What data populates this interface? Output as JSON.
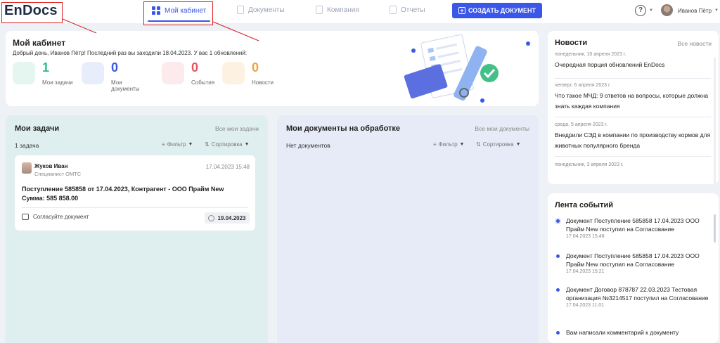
{
  "app": {
    "logo": "EnDocs"
  },
  "nav": {
    "cabinet": "Мой кабинет",
    "documents": "Документы",
    "company": "Компания",
    "reports": "Отчеты",
    "create": "СОЗДАТЬ ДОКУМЕНТ"
  },
  "user": {
    "name": "Иванов Пётр"
  },
  "cabinet": {
    "title": "Мой кабинет",
    "subtitle": "Добрый день, Иванов Пётр! Последний раз вы заходили 18.04.2023.  У вас 1 обновлений:",
    "stats": [
      {
        "value": "1",
        "label": "Мои задачи",
        "color": "#2fbf8a"
      },
      {
        "value": "0",
        "label": "Мои документы",
        "color": "#3a57e8"
      },
      {
        "value": "0",
        "label": "События",
        "color": "#e8545c"
      },
      {
        "value": "0",
        "label": "Новости",
        "color": "#f4a23a"
      }
    ]
  },
  "tasks": {
    "title": "Мои задачи",
    "link": "Все мои задачи",
    "count": "1 задача",
    "filter": "Фильтр",
    "sort": "Сортировка",
    "card": {
      "name": "Жуков Иван",
      "role": "Специалист ОМТС",
      "date": "17.04.2023 15:48",
      "text": "Поступление 585858 от 17.04.2023, Контрагент - ООО Прайм New Сумма: 585 858.00",
      "action": "Согласуйте документ",
      "due": "19.04.2023"
    }
  },
  "docs": {
    "title": "Мои документы на обработке",
    "link": "Все мои документы",
    "empty": "Нет документов",
    "filter": "Фильтр",
    "sort": "Сортировка"
  },
  "news": {
    "title": "Новости",
    "link": "Все новости",
    "items": [
      {
        "date": "понедельник, 10 апреля 2023 г.",
        "text": "Очередная порция обновлений EnDocs"
      },
      {
        "date": "четверг, 6 апреля 2023 г.",
        "text": "Что такое МЧД: 9 ответов на вопросы, которые должна знать каждая компания"
      },
      {
        "date": "среда, 5 апреля 2023 г.",
        "text": "Внедрили СЭД в компании по производству кормов для животных популярного бренда"
      },
      {
        "date": "понедельник, 3 апреля 2023 г.",
        "text": ""
      }
    ]
  },
  "events": {
    "title": "Лента событий",
    "items": [
      {
        "text": "Документ Поступление 585858 17.04.2023 ООО Прайм New поступил на Согласование",
        "date": "17.04.2023 15:48"
      },
      {
        "text": "Документ Поступление 585858 17.04.2023 ООО Прайм New поступил на Согласование",
        "date": "17.04.2023 15:21"
      },
      {
        "text": "Документ Договор 878787 22.03.2023 Тестовая организация №3214517 поступил на Согласование",
        "date": "17.04.2023 11:01"
      },
      {
        "text": "Вам написали комментарий к документу",
        "date": ""
      }
    ]
  },
  "icons": [
    "grid-icon",
    "document-icon",
    "company-icon",
    "reports-icon",
    "plus-icon",
    "help-icon",
    "filter-icon",
    "sort-icon",
    "comment-icon",
    "clock-icon"
  ]
}
